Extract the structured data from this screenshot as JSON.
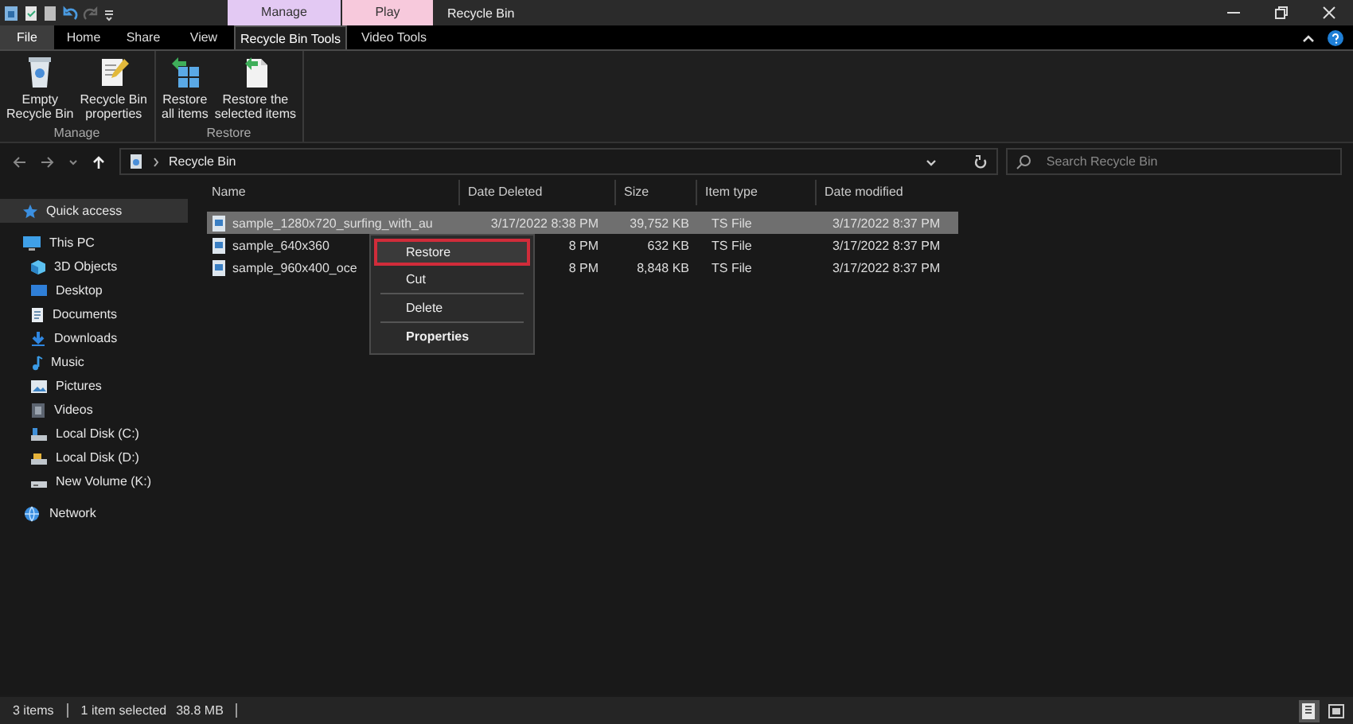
{
  "window": {
    "title": "Recycle Bin",
    "tool_groups": [
      {
        "label": "Manage",
        "color": "#e3c9f3"
      },
      {
        "label": "Play",
        "color": "#f7c9dc"
      }
    ]
  },
  "ribbon": {
    "tabs": [
      {
        "label": "File",
        "kind": "file",
        "selected": false
      },
      {
        "label": "Home",
        "kind": "tab",
        "selected": false
      },
      {
        "label": "Share",
        "kind": "tab",
        "selected": false
      },
      {
        "label": "View",
        "kind": "tab",
        "selected": false
      },
      {
        "label": "Recycle Bin Tools",
        "kind": "tab",
        "selected": true
      },
      {
        "label": "Video Tools",
        "kind": "tab",
        "selected": false
      }
    ],
    "groups": [
      {
        "label": "Manage",
        "buttons": [
          "Empty\nRecycle Bin",
          "Recycle Bin\nproperties"
        ]
      },
      {
        "label": "Restore",
        "buttons": [
          "Restore\nall items",
          "Restore the\nselected items"
        ]
      }
    ]
  },
  "address_bar": {
    "path": "Recycle Bin",
    "search": {
      "placeholder": "Search Recycle Bin"
    }
  },
  "navigation": {
    "items": [
      {
        "label": "Quick access",
        "selected": true
      },
      {
        "label": "This PC",
        "selected": false,
        "children": [
          {
            "label": "3D Objects",
            "selected": false
          },
          {
            "label": "Desktop",
            "selected": false
          },
          {
            "label": "Documents",
            "selected": false
          },
          {
            "label": "Downloads",
            "selected": false
          },
          {
            "label": "Music",
            "selected": false
          },
          {
            "label": "Pictures",
            "selected": false
          },
          {
            "label": "Videos",
            "selected": false
          },
          {
            "label": "Local Disk (C:)",
            "selected": false
          },
          {
            "label": "Local Disk (D:)",
            "selected": false
          },
          {
            "label": "New Volume (K:)",
            "selected": false
          }
        ]
      },
      {
        "label": "Network",
        "selected": false
      }
    ]
  },
  "file_list": {
    "columns": [
      "Name",
      "Date Deleted",
      "Size",
      "Item type",
      "Date modified"
    ],
    "rows": [
      {
        "name": "sample_1280x720_surfing_with_au",
        "date_deleted": "3/17/2022 8:38 PM",
        "size": "39,752 KB",
        "item_type": "TS File",
        "date_modified": "3/17/2022 8:37 PM",
        "selected": true
      },
      {
        "name": "sample_640x360",
        "date_deleted": "8 PM",
        "size": "632 KB",
        "item_type": "TS File",
        "date_modified": "3/17/2022 8:37 PM",
        "selected": false
      },
      {
        "name": "sample_960x400_oce",
        "date_deleted": "8 PM",
        "size": "8,848 KB",
        "item_type": "TS File",
        "date_modified": "3/17/2022 8:37 PM",
        "selected": false
      }
    ]
  },
  "context_menu": {
    "items": [
      {
        "kind": "action",
        "label": "Restore",
        "selected": true
      },
      {
        "kind": "action",
        "label": "Cut",
        "selected": false
      },
      {
        "kind": "separator"
      },
      {
        "kind": "action",
        "label": "Delete",
        "selected": false
      },
      {
        "kind": "separator"
      },
      {
        "kind": "default",
        "label": "Properties",
        "selected": false
      }
    ]
  },
  "status_bar": {
    "item_count": "3 items",
    "selection": "1 item selected",
    "selection_size": "38.8 MB",
    "views": [
      {
        "kind": "details",
        "selected": true
      },
      {
        "kind": "large_icons",
        "selected": false
      }
    ]
  }
}
